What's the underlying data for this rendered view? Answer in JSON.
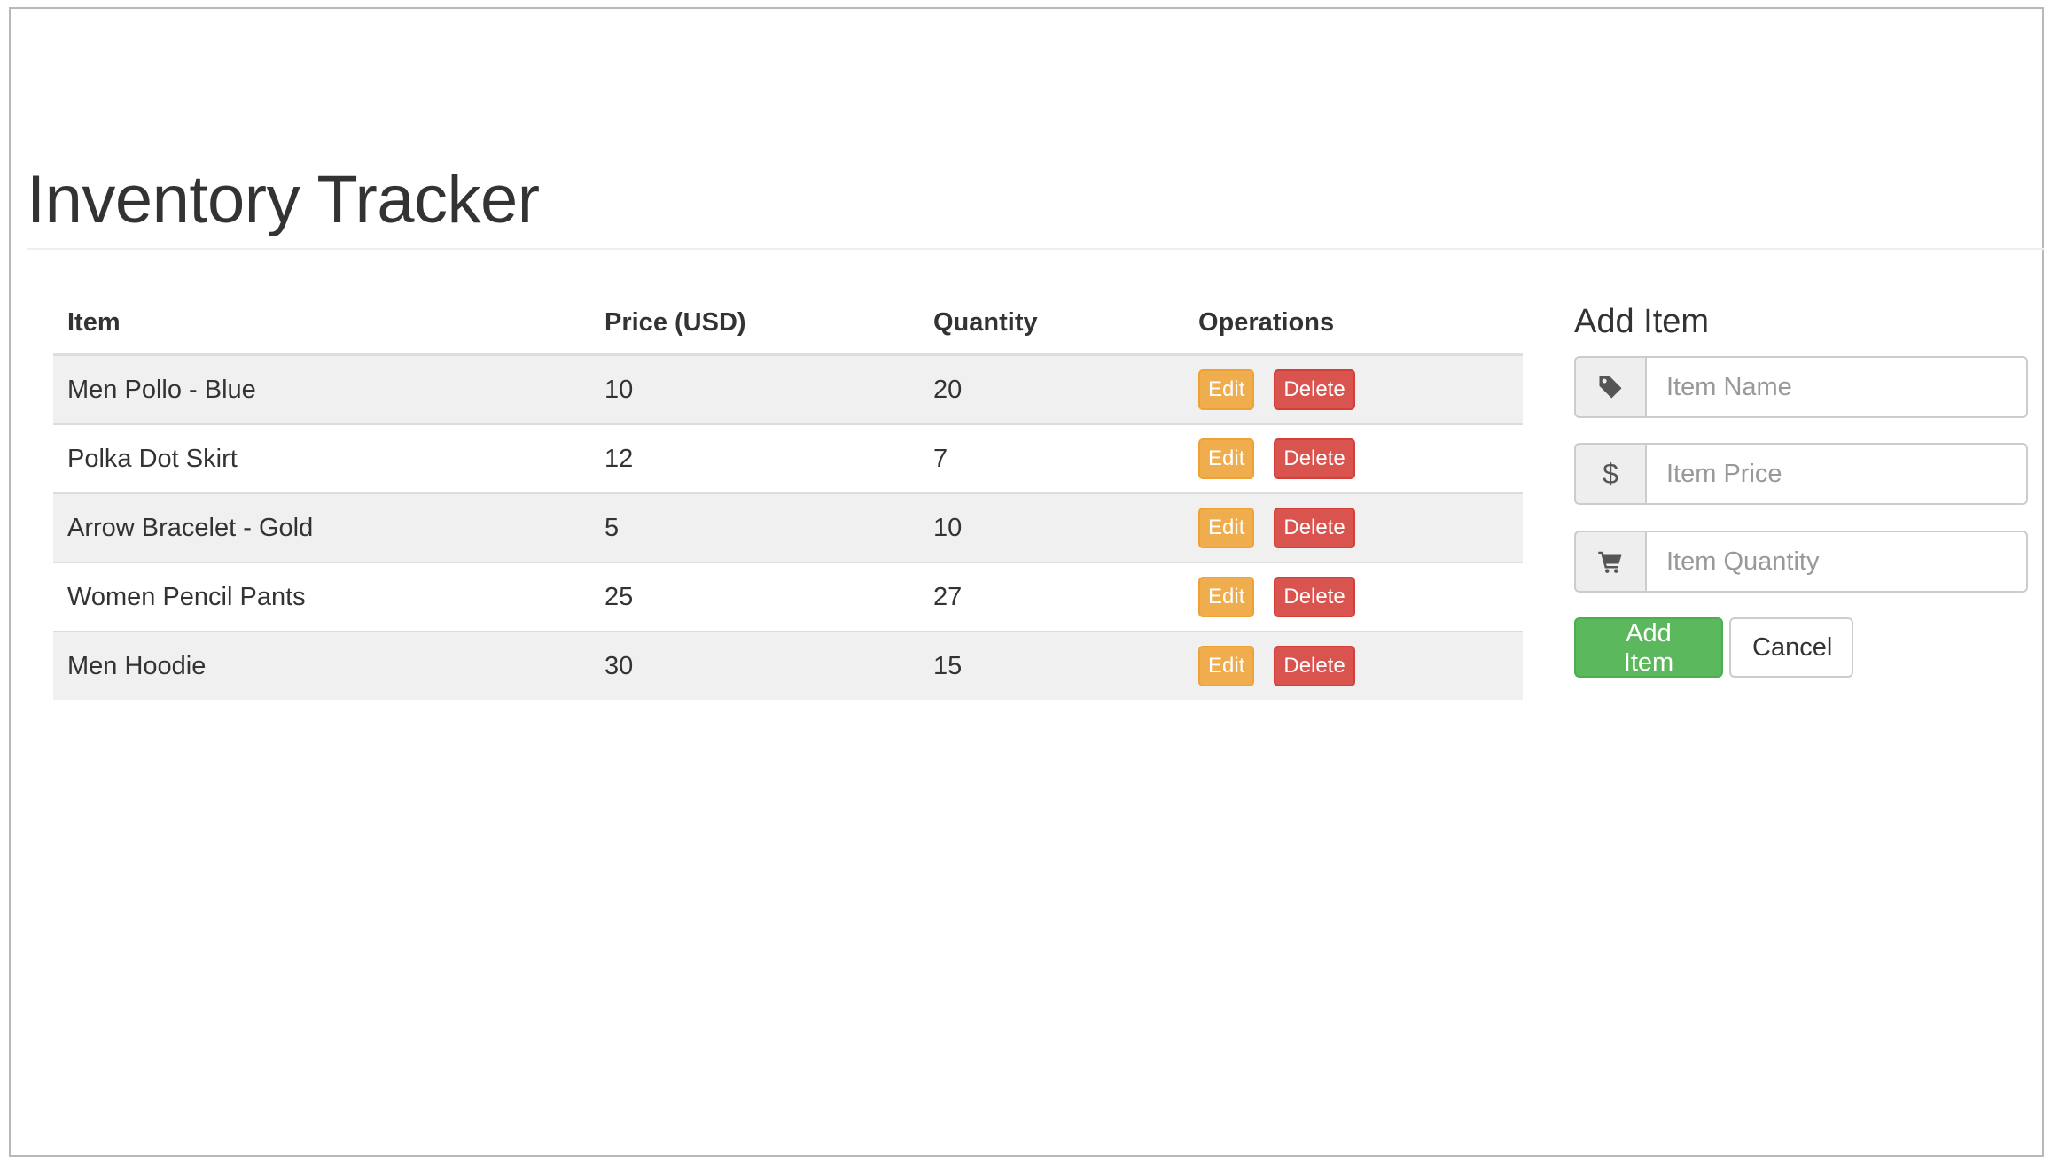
{
  "page": {
    "title": "Inventory Tracker"
  },
  "table": {
    "headers": {
      "item": "Item",
      "price": "Price (USD)",
      "quantity": "Quantity",
      "operations": "Operations"
    },
    "edit_label": "Edit",
    "delete_label": "Delete",
    "rows": [
      {
        "item": "Men Pollo - Blue",
        "price": "10",
        "quantity": "20"
      },
      {
        "item": "Polka Dot Skirt",
        "price": "12",
        "quantity": "7"
      },
      {
        "item": "Arrow Bracelet - Gold",
        "price": "5",
        "quantity": "10"
      },
      {
        "item": "Women Pencil Pants",
        "price": "25",
        "quantity": "27"
      },
      {
        "item": "Men Hoodie",
        "price": "30",
        "quantity": "15"
      }
    ]
  },
  "form": {
    "title": "Add Item",
    "name_placeholder": "Item Name",
    "price_placeholder": "Item Price",
    "quantity_placeholder": "Item Quantity",
    "price_addon": "$",
    "add_label": "Add Item",
    "cancel_label": "Cancel",
    "icons": {
      "name": "tag-icon",
      "price": "dollar-icon",
      "quantity": "shopping-cart-icon"
    }
  },
  "colors": {
    "edit": "#f0ad4e",
    "delete": "#d9534f",
    "add": "#5cb85c",
    "stripe": "#f0f0f0"
  }
}
